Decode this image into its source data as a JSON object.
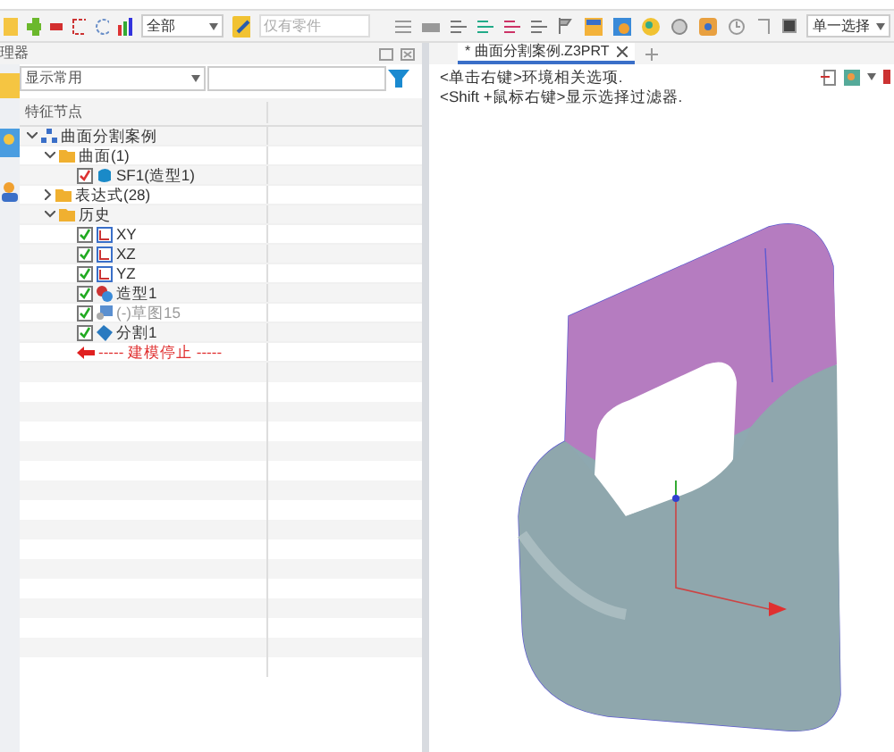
{
  "toolbar": {
    "filter_value": "全部",
    "select_value": "仅有零件",
    "mode_value": "单一选择"
  },
  "manager": {
    "title": "理器",
    "display": "显示常用",
    "column": "特征节点"
  },
  "tree": [
    {
      "label": "曲面分割案例",
      "expanded": true,
      "children": [
        {
          "label": "曲面(1)",
          "expanded": true,
          "children": [
            {
              "label": "SF1(造型1)",
              "checked": true,
              "kind": "surface"
            }
          ]
        },
        {
          "label": "表达式(28)",
          "expanded": false
        },
        {
          "label": "历史",
          "expanded": true,
          "children": [
            {
              "label": "XY",
              "checked": true,
              "kind": "plane"
            },
            {
              "label": "XZ",
              "checked": true,
              "kind": "plane"
            },
            {
              "label": "YZ",
              "checked": true,
              "kind": "plane"
            },
            {
              "label": "造型1",
              "checked": true,
              "kind": "shape"
            },
            {
              "label": "(-)草图15",
              "checked": true,
              "kind": "sketch",
              "disabled": true
            },
            {
              "label": "分割1",
              "checked": true,
              "kind": "split"
            },
            {
              "label": "----- 建模停止 -----",
              "kind": "stop"
            }
          ]
        }
      ]
    }
  ],
  "tabs": [
    {
      "label": "* 曲面分割案例.Z3PRT",
      "selected": true
    }
  ],
  "hints": [
    "<单击右键>环境相关选项.",
    "<Shift +鼠标右键>显示选择过滤器."
  ]
}
